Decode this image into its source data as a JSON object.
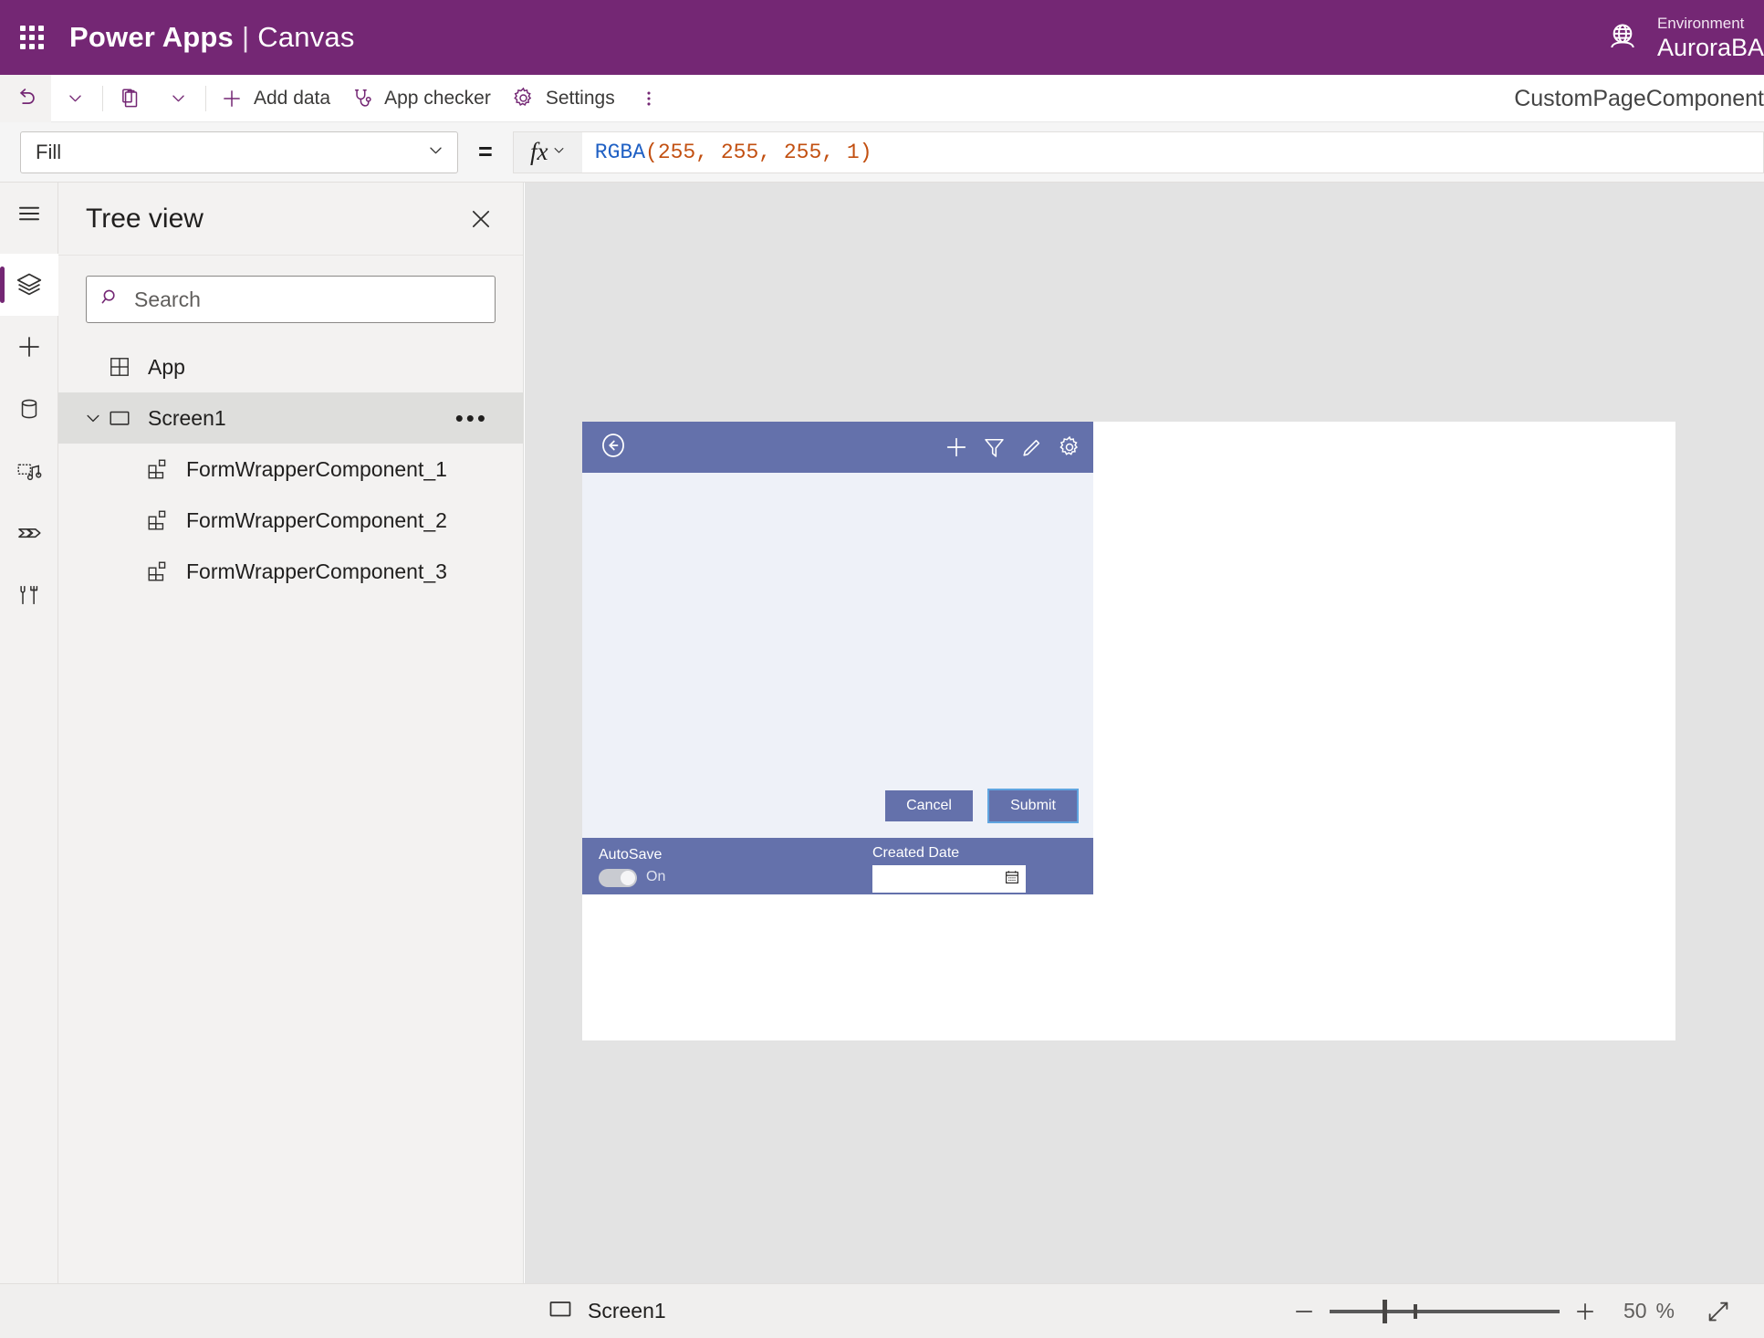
{
  "header": {
    "waffle_icon": "app-launcher-icon",
    "product": "Power Apps",
    "separator": "|",
    "app_type": "Canvas",
    "environment_icon": "globe-environment-icon",
    "environment_label": "Environment",
    "environment_name": "AuroraBA"
  },
  "commandbar": {
    "undo_icon": "undo-icon",
    "undo_caret_icon": "chevron-down-icon",
    "paste_icon": "clipboard-paste-icon",
    "paste_caret_icon": "chevron-down-icon",
    "add_data_icon": "plus-icon",
    "add_data_label": "Add data",
    "app_checker_icon": "stethoscope-icon",
    "app_checker_label": "App checker",
    "settings_icon": "gear-icon",
    "settings_label": "Settings",
    "more_icon": "more-vertical-icon",
    "component_name": "CustomPageComponent"
  },
  "formula_bar": {
    "property": "Fill",
    "property_caret_icon": "chevron-down-icon",
    "equals": "=",
    "fx_icon": "fx-icon",
    "fx_caret_icon": "chevron-down-icon",
    "formula_fn": "RGBA",
    "formula_open": "(",
    "formula_args": [
      "255",
      "255",
      "255",
      "1"
    ],
    "formula_close": ")",
    "formula_full": "RGBA(255, 255, 255, 1)"
  },
  "rail": {
    "items": [
      {
        "icon": "hamburger-menu-icon",
        "active": false
      },
      {
        "icon": "layers-tree-view-icon",
        "active": true
      },
      {
        "icon": "plus-insert-icon",
        "active": false
      },
      {
        "icon": "database-data-icon",
        "active": false
      },
      {
        "icon": "media-icon",
        "active": false
      },
      {
        "icon": "power-automate-icon",
        "active": false
      },
      {
        "icon": "tools-variables-icon",
        "active": false
      }
    ]
  },
  "treeview": {
    "title": "Tree view",
    "close_icon": "close-icon",
    "search_icon": "search-icon",
    "search_placeholder": "Search",
    "search_value": "",
    "items": [
      {
        "label": "App",
        "icon": "app-icon",
        "indent": 0,
        "selected": false,
        "expandable": false,
        "more": false
      },
      {
        "label": "Screen1",
        "icon": "screen-icon",
        "indent": 0,
        "selected": true,
        "expandable": true,
        "expand_icon": "chevron-down-icon",
        "more": true,
        "more_icon": "more-horizontal-icon"
      },
      {
        "label": "FormWrapperComponent_1",
        "icon": "component-icon",
        "indent": 1,
        "selected": false,
        "expandable": false,
        "more": false
      },
      {
        "label": "FormWrapperComponent_2",
        "icon": "component-icon",
        "indent": 1,
        "selected": false,
        "expandable": false,
        "more": false
      },
      {
        "label": "FormWrapperComponent_3",
        "icon": "component-icon",
        "indent": 1,
        "selected": false,
        "expandable": false,
        "more": false
      }
    ]
  },
  "canvas": {
    "app_preview": {
      "back_icon": "back-arrow-circle-icon",
      "topbar_icons": [
        {
          "icon": "plus-icon"
        },
        {
          "icon": "filter-icon"
        },
        {
          "icon": "pencil-edit-icon"
        },
        {
          "icon": "gear-settings-icon"
        }
      ],
      "cancel_label": "Cancel",
      "submit_label": "Submit",
      "submit_selected": true,
      "autosave_label": "AutoSave",
      "autosave_state": "On",
      "created_date_label": "Created Date",
      "created_date_value": "",
      "calendar_icon": "calendar-icon"
    }
  },
  "statusbar": {
    "screen_icon": "screen-icon",
    "screen_label": "Screen1",
    "zoom_out_icon": "minus-icon",
    "zoom_in_icon": "plus-icon",
    "zoom_value": "50",
    "zoom_unit": "%",
    "fullscreen_icon": "expand-diagonal-icon"
  },
  "colors": {
    "brand_purple": "#742774",
    "app_accent_blue": "#6471ab",
    "app_body_bg": "#eef1f8",
    "selection_blue": "#60a5e0",
    "workspace_gray": "#e3e3e3",
    "panel_gray": "#f3f2f1"
  }
}
